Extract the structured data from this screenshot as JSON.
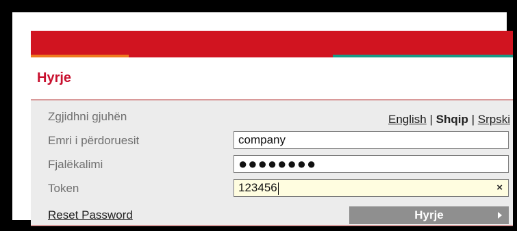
{
  "login": {
    "title": "Hyrje",
    "language_label": "Zgjidhni gjuhën",
    "languages": {
      "english": "English",
      "separator1": "|",
      "shqip": "Shqip",
      "separator2": "|",
      "srpski": "Srpski"
    },
    "username_label": "Emri i përdoruesit",
    "username_value": "company",
    "password_label": "Fjalëkalimi",
    "password_value": "●●●●●●●●",
    "token_label": "Token",
    "token_value": "123456",
    "clear_symbol": "×",
    "reset_link": "Reset Password",
    "submit_label": "Hyrje"
  },
  "colors": {
    "header_red": "#d11420",
    "stripe_orange": "#ee7a1e",
    "stripe_teal": "#1a9a86",
    "title_red": "#c8102e",
    "panel_bg": "#ececec",
    "button_gray": "#8f8f8f"
  }
}
